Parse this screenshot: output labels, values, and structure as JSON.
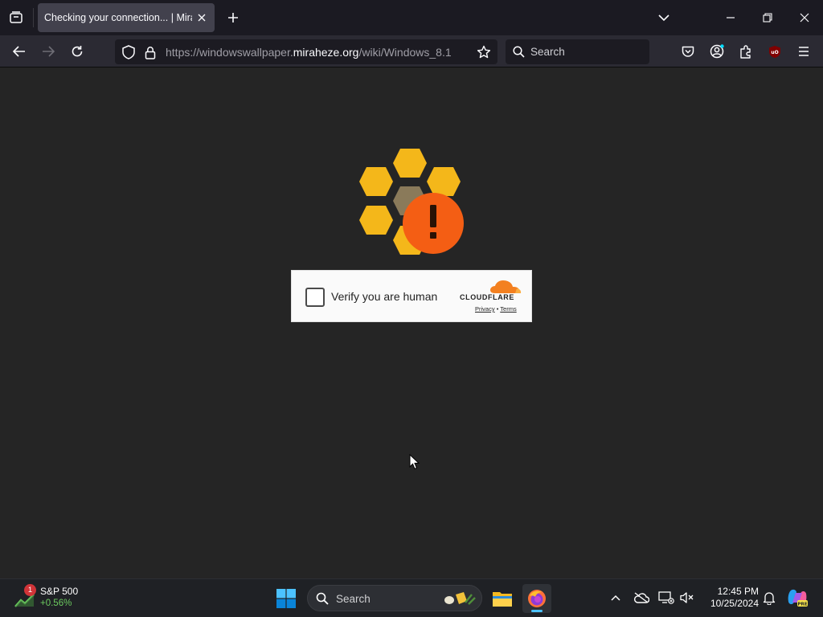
{
  "browser": {
    "tab": {
      "title": "Checking your connection... | Miraheze"
    },
    "url": {
      "prefix": "https://windowswallpaper.",
      "host": "miraheze.org",
      "path": "/wiki/Windows_8.1"
    },
    "search": {
      "placeholder": "Search"
    }
  },
  "challenge": {
    "checkbox_label": "Verify you are human",
    "brand": "CLOUDFLARE",
    "privacy_label": "Privacy",
    "separator": "•",
    "terms_label": "Terms"
  },
  "taskbar": {
    "stock": {
      "name": "S&P 500",
      "change": "+0.56%",
      "badge": "1"
    },
    "search_label": "Search",
    "clock": {
      "time": "12:45 PM",
      "date": "10/25/2024"
    }
  },
  "colors": {
    "hex_yellow": "#f4b71a",
    "alert_orange": "#f45e14",
    "cloudflare_orange": "#f38020",
    "browser_bg": "#252525"
  },
  "icons": [
    "tab-list-icon",
    "close-icon",
    "plus-icon",
    "chevron-down-icon",
    "minimize-icon",
    "restore-icon",
    "back-icon",
    "forward-icon",
    "reload-icon",
    "shield-icon",
    "lock-icon",
    "star-icon",
    "search-icon",
    "pocket-icon",
    "account-icon",
    "extensions-icon",
    "ublock-icon",
    "menu-icon",
    "windows-start-icon",
    "file-explorer-icon",
    "firefox-icon",
    "chevron-up-icon",
    "onedrive-icon",
    "network-icon",
    "volume-icon",
    "bell-icon",
    "copilot-icon",
    "exclamation-icon",
    "cloudflare-cloud-icon"
  ]
}
